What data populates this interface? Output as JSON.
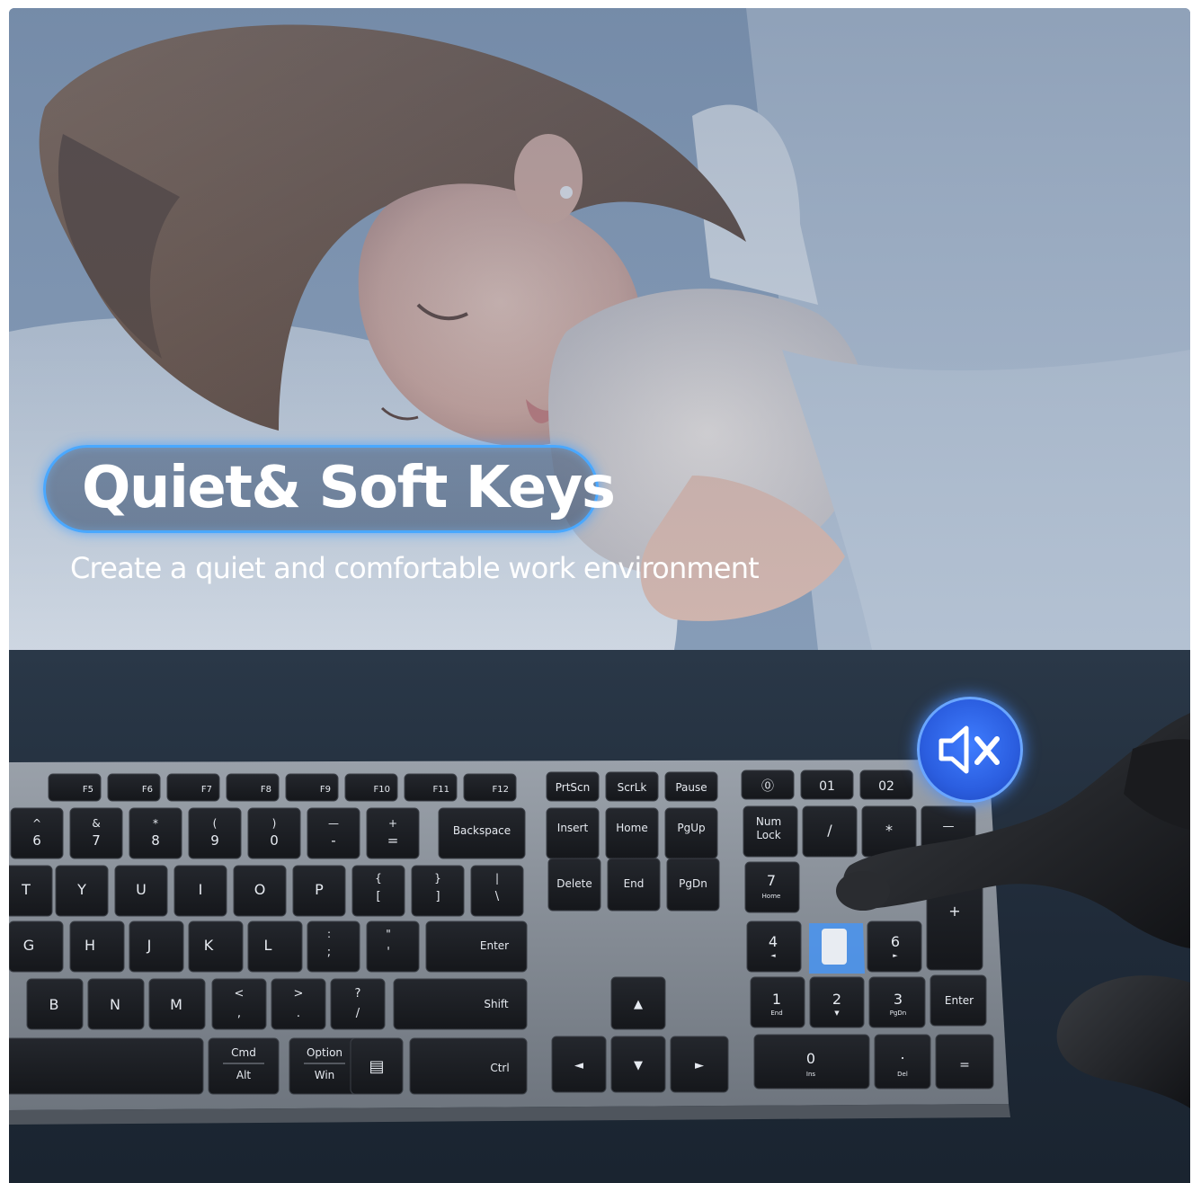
{
  "hero": {
    "title": "Quiet& Soft Keys",
    "subtitle": "Create a quiet and comfortable work environment"
  },
  "mute_icon": "speaker-mute-icon",
  "colors": {
    "accent_blue": "#3f7dff",
    "pill_border": "#4aa8ff",
    "keycap": "#1b1d22",
    "keyboard_frame": "#8a919a"
  },
  "keyboard": {
    "fkeys": [
      "F5",
      "F6",
      "F7",
      "F8",
      "F9",
      "F10",
      "F11",
      "F12"
    ],
    "nav_top": [
      "PrtScn",
      "ScrLk",
      "Pause"
    ],
    "num_row": [
      {
        "top": "^",
        "bottom": "6"
      },
      {
        "top": "&",
        "bottom": "7"
      },
      {
        "top": "*",
        "bottom": "8"
      },
      {
        "top": "(",
        "bottom": "9"
      },
      {
        "top": ")",
        "bottom": "0"
      },
      {
        "top": "—",
        "bottom": "-"
      },
      {
        "top": "+",
        "bottom": "="
      }
    ],
    "backspace": "Backspace",
    "nav_mid1": [
      "Insert",
      "Home",
      "PgUp"
    ],
    "nav_mid2": [
      "Delete",
      "End",
      "PgDn"
    ],
    "qwerty": [
      "T",
      "Y",
      "U",
      "I",
      "O",
      "P"
    ],
    "qwerty_sym": [
      {
        "top": "{",
        "bottom": "["
      },
      {
        "top": "}",
        "bottom": "]"
      },
      {
        "top": "|",
        "bottom": "\\"
      }
    ],
    "home_row": [
      "G",
      "H",
      "J",
      "K",
      "L"
    ],
    "home_sym": [
      {
        "top": ":",
        "bottom": ";"
      },
      {
        "top": "\"",
        "bottom": "'"
      }
    ],
    "enter": "Enter",
    "bottom_row": [
      "B",
      "N",
      "M"
    ],
    "bottom_sym": [
      {
        "top": "<",
        "bottom": ","
      },
      {
        "top": ">",
        "bottom": "."
      },
      {
        "top": "?",
        "bottom": "/"
      }
    ],
    "shift": "Shift",
    "mod_keys": [
      {
        "top": "Cmd",
        "bottom": "Alt"
      },
      {
        "top": "Option",
        "bottom": "Win"
      }
    ],
    "ctrl": "Ctrl",
    "arrows": [
      "▲",
      "◄",
      "▼",
      "►"
    ],
    "numpad": {
      "num_lock": [
        "Num",
        "Lock"
      ],
      "slash": "/",
      "star": "*",
      "minus": "—",
      "plus": "+",
      "k7": {
        "main": "7",
        "sub": "Home"
      },
      "k4": {
        "main": "4",
        "sub": "◄"
      },
      "k6": {
        "main": "6",
        "sub": "►"
      },
      "k1": {
        "main": "1",
        "sub": "End"
      },
      "k2": {
        "main": "2",
        "sub": "▼"
      },
      "k3": {
        "main": "3",
        "sub": "PgDn"
      },
      "k0": {
        "main": "0",
        "sub": "Ins"
      },
      "dot": {
        "main": ".",
        "sub": "Del"
      },
      "enter": "Enter",
      "equals": "="
    },
    "device_keys": [
      "⓪",
      "01",
      "02"
    ]
  }
}
